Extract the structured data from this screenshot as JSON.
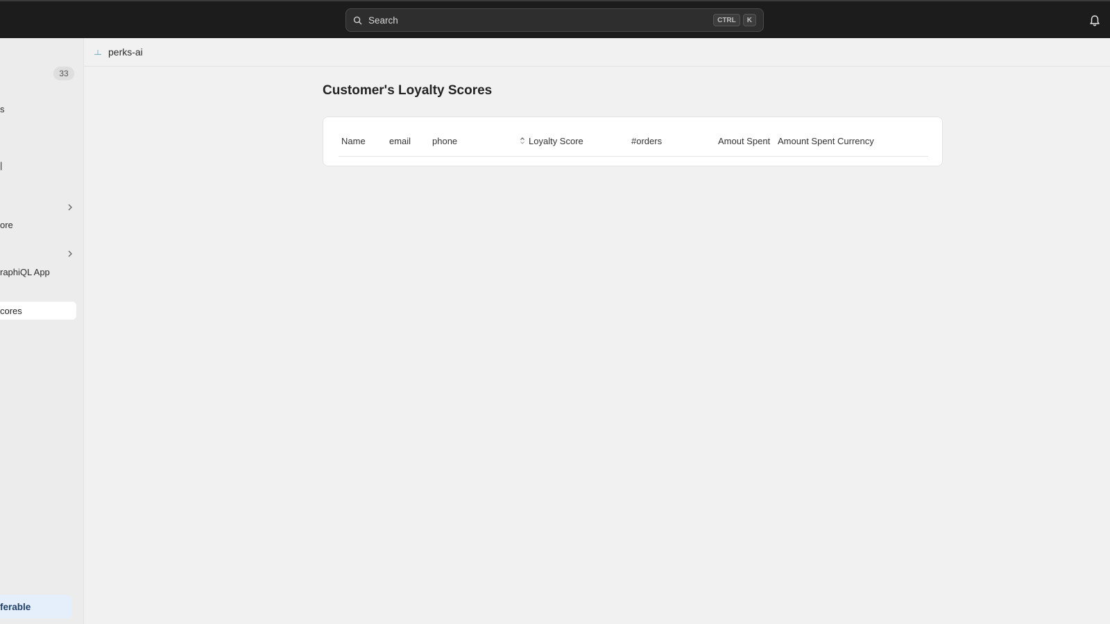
{
  "topbar": {
    "search_placeholder": "Search",
    "shortcut_ctrl": "CTRL",
    "shortcut_key": "K"
  },
  "sidebar": {
    "badge_count": "33",
    "items": [
      {
        "label": "s"
      },
      {
        "label": "ore"
      },
      {
        "label": "raphiQL App"
      },
      {
        "label": "cores"
      }
    ],
    "bottom_label": "ferable"
  },
  "breadcrumb": {
    "app_name": "perks-ai"
  },
  "main": {
    "title": "Customer's Loyalty Scores",
    "columns": [
      "Name",
      "email",
      "phone",
      "Loyalty Score",
      "#orders",
      "Amout Spent",
      "Amount Spent Currency"
    ]
  },
  "colors": {
    "topbar_bg": "#1c1c1c",
    "page_bg": "#f1f1f1",
    "accent_bottom": "#e4effb"
  }
}
